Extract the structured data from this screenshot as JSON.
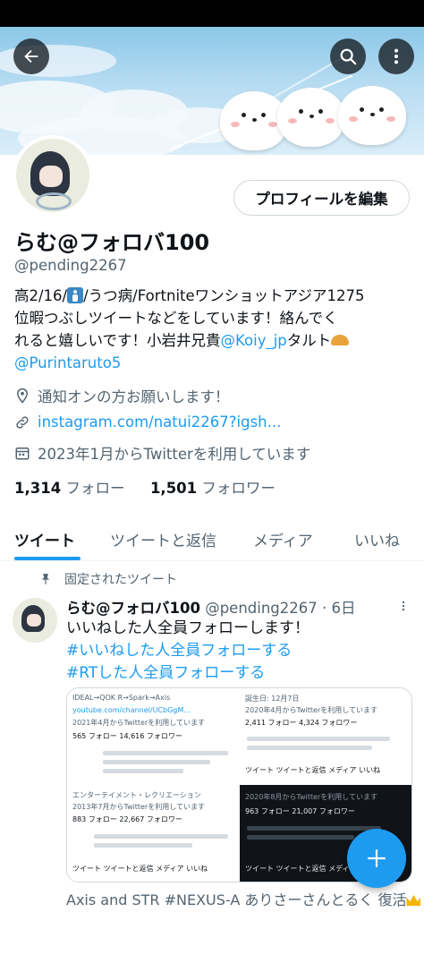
{
  "profile": {
    "name": "らむ@フォロバ100",
    "handle": "@pending2267",
    "edit_button": "プロフィールを編集",
    "bio_lines": {
      "l1_a": "高2/16/",
      "l1_b": "/うつ病/Fortniteワンショットアジア1275",
      "l2": "位暇つぶしツイートなどをしています！絡んでく",
      "l3_a": "れると嬉しいです！小岩井兄貴",
      "l3_link": "@Koiy_jp",
      "l3_b": "タルト",
      "l4_link": "@Purintaruto5"
    },
    "location": "通知オンの方お願いします！",
    "website": "instagram.com/natui2267?igsh...",
    "joined": "2023年1月からTwitterを利用しています",
    "following_count": "1,314",
    "following_label": "フォロー",
    "followers_count": "1,501",
    "followers_label": "フォロワー"
  },
  "tabs": [
    "ツイート",
    "ツイートと返信",
    "メディア",
    "いいね"
  ],
  "pinned_label": "固定されたツイート",
  "tweet": {
    "name": "らむ@フォロバ100",
    "meta": "@pending2267 · 6日",
    "lines": {
      "l1": "いいねした人全員フォローします！",
      "l2": "#いいねした人全員フォローする",
      "l3": "#RTした人全員フォローする"
    },
    "next_preview": "Axis and STR #NEXUS-A ありさーさんとるく 復活"
  },
  "mosaic_text": {
    "q1_a": "IDEAL→QOK R→Spark→Axis",
    "q1_b": "youtube.com/channel/UCbGgM...",
    "q1_c": "2021年4月からTwitterを利用しています",
    "q1_d": "565 フォロー  14,616 フォロワー",
    "q2_a": "誕生日: 12月7日",
    "q2_b": "2020年4月からTwitterを利用しています",
    "q2_c": "2,411 フォロー  4,324 フォロワー",
    "q3_a": "エンターテイメント・レクリエーション",
    "q3_b": "2013年7月からTwitterを利用しています",
    "q3_c": "883 フォロー  22,667 フォロワー",
    "q4_a": "2020年8月からTwitterを利用しています",
    "q4_b": "963 フォロー  21,007 フォロワー",
    "mini_tabs": "ツイート  ツイートと返信  メディア  いいね"
  },
  "colors": {
    "accent": "#1d9bf0",
    "text": "#0f1419",
    "muted": "#536471",
    "border": "#cfd9de"
  },
  "icons": [
    "back-arrow-icon",
    "search-icon",
    "more-vertical-icon",
    "location-icon",
    "link-icon",
    "calendar-icon",
    "pin-icon",
    "more-horizontal-icon",
    "plus-icon"
  ]
}
